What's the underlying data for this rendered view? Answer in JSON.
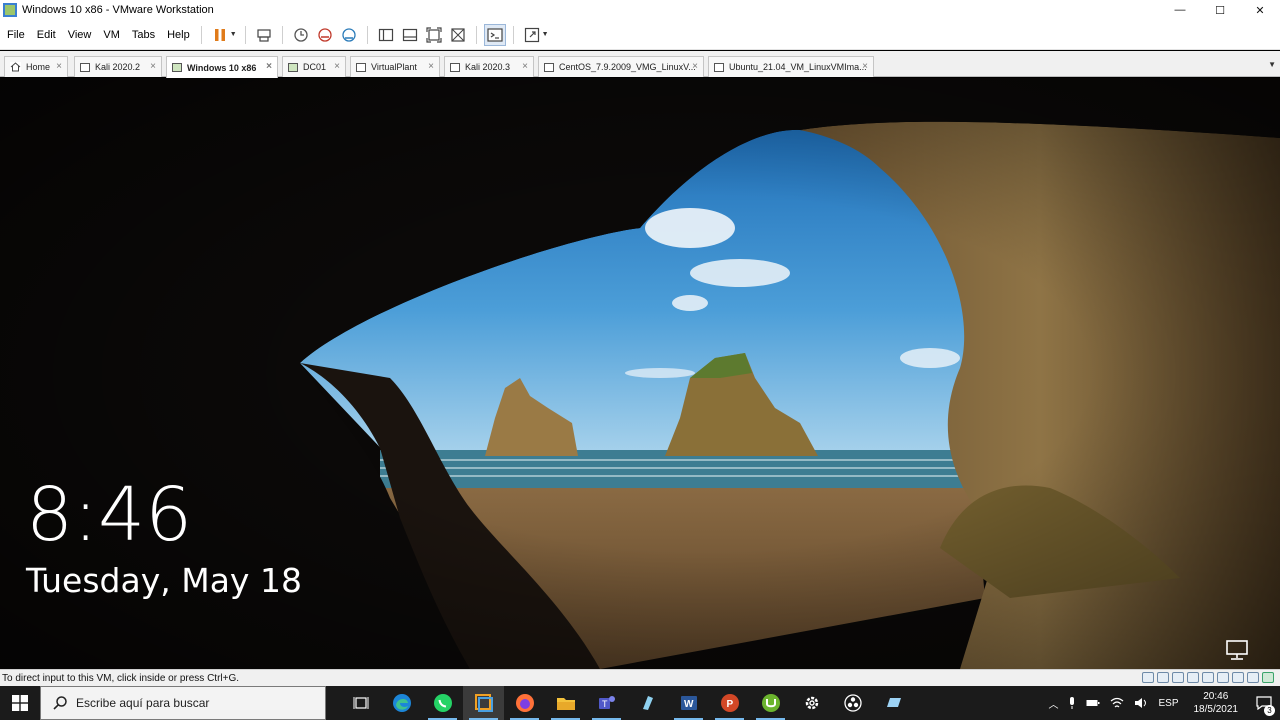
{
  "window": {
    "title": "Windows 10 x86 - VMware Workstation",
    "minimize_label": "—",
    "maximize_label": "☐",
    "close_label": "✕"
  },
  "menu": {
    "file": "File",
    "edit": "Edit",
    "view": "View",
    "vm": "VM",
    "tabs": "Tabs",
    "help": "Help"
  },
  "toolbar": {
    "icons": [
      "pause-icon",
      "send-keys-icon",
      "snapshot-icon",
      "revert-snapshot-icon",
      "snapshot-manager-icon",
      "library-icon",
      "thumbnail-icon",
      "full-screen-icon",
      "unity-icon",
      "console-icon",
      "stretch-icon"
    ]
  },
  "tabs": [
    {
      "label": "Home",
      "close": "×"
    },
    {
      "label": "Kali 2020.2",
      "close": "×"
    },
    {
      "label": "Windows 10 x86",
      "close": "×"
    },
    {
      "label": "DC01",
      "close": "×"
    },
    {
      "label": "VirtualPlant",
      "close": "×"
    },
    {
      "label": "Kali 2020.3",
      "close": "×"
    },
    {
      "label": "CentOS_7.9.2009_VMG_LinuxV...",
      "close": "×"
    },
    {
      "label": "Ubuntu_21.04_VM_LinuxVMIma...",
      "close": "×"
    }
  ],
  "active_tab": "Windows 10 x86",
  "lockscreen": {
    "time": "8:46",
    "date": "Tuesday, May 18"
  },
  "statusbar": {
    "hint": "To direct input to this VM, click inside or press Ctrl+G."
  },
  "taskbar": {
    "search_placeholder": "Escribe aquí para buscar",
    "apps": [
      "task-view-icon",
      "edge-icon",
      "whatsapp-icon",
      "vmware-icon",
      "firefox-icon",
      "file-explorer-icon",
      "teams-icon",
      "app-icon",
      "word-icon",
      "powerpoint-icon",
      "utorrent-icon",
      "settings-icon",
      "obs-icon",
      "app2-icon"
    ],
    "tray": {
      "language": "ESP",
      "time": "20:46",
      "date": "18/5/2021",
      "notification_count": "3"
    }
  },
  "colors": {
    "accent": "#76b9ed",
    "taskbar_bg": "#1b1b1b"
  }
}
